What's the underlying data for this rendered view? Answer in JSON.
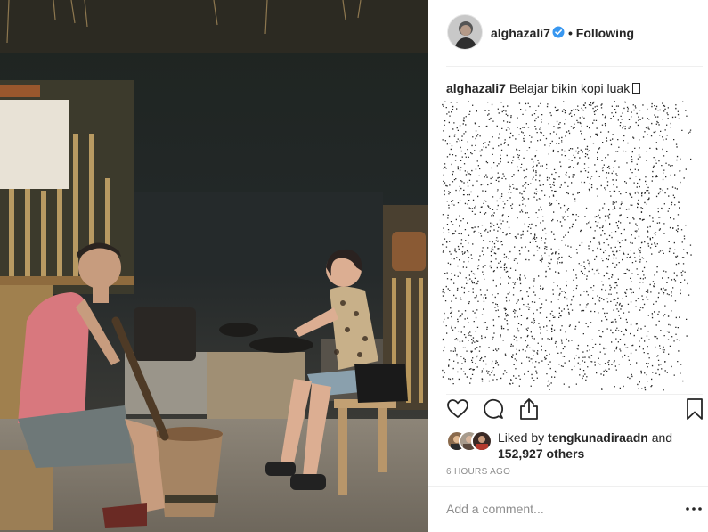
{
  "post": {
    "author": "alghazali7",
    "follow_status": "• Following",
    "caption_user": "alghazali7",
    "caption_text": "Belajar bikin kopi luak"
  },
  "likes": {
    "prefix": "Liked by ",
    "top_liker": "tengkunadiraadn",
    "joiner": " and",
    "count_text": "152,927 others"
  },
  "timestamp": "6 HOURS AGO",
  "comment_box": {
    "placeholder": "Add a comment..."
  },
  "icons": {
    "verified": "verified-badge-icon",
    "like": "heart-icon",
    "comment": "comment-bubble-icon",
    "share": "share-icon",
    "save": "bookmark-icon",
    "more": "more-options-icon"
  },
  "colors": {
    "verified_blue": "#3897f0",
    "muted_text": "#8e8e8e",
    "divider": "#efefef"
  }
}
